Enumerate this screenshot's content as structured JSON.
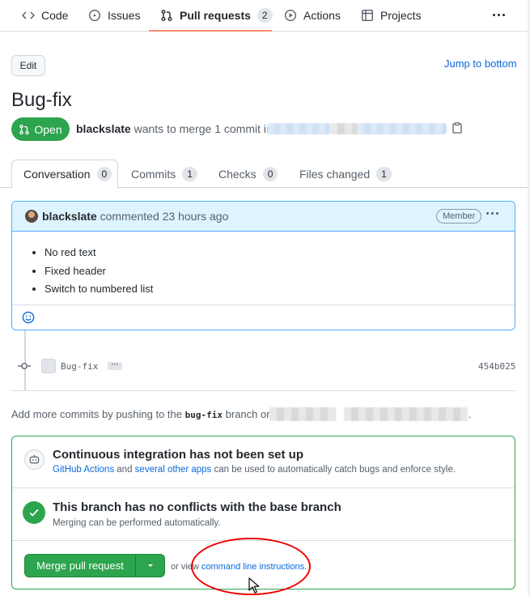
{
  "nav": {
    "items": [
      {
        "label": "Code",
        "icon": "code-icon"
      },
      {
        "label": "Issues",
        "icon": "issue-opened-icon"
      },
      {
        "label": "Pull requests",
        "icon": "git-pull-request-icon",
        "count": "2",
        "active": true
      },
      {
        "label": "Actions",
        "icon": "play-icon"
      },
      {
        "label": "Projects",
        "icon": "table-icon"
      }
    ]
  },
  "header": {
    "edit_label": "Edit",
    "jump_label": "Jump to bottom",
    "title": "Bug-fix",
    "state_label": "Open",
    "author": "blackslate",
    "merge_text": "wants to merge 1 commit into"
  },
  "tabs": [
    {
      "label": "Conversation",
      "count": "0"
    },
    {
      "label": "Commits",
      "count": "1"
    },
    {
      "label": "Checks",
      "count": "0"
    },
    {
      "label": "Files changed",
      "count": "1"
    }
  ],
  "comment": {
    "author": "blackslate",
    "action": "commented 23 hours ago",
    "badge": "Member",
    "items": [
      "No red text",
      "Fixed header",
      "Switch to numbered list"
    ]
  },
  "commit": {
    "message": "Bug-fix",
    "ellipsis": "···",
    "sha": "454b025"
  },
  "hint": {
    "before": "Add more commits by pushing to the",
    "branch": "bug-fix",
    "after": "branch on",
    "end": "."
  },
  "merge": {
    "ci_title": "Continuous integration has not been set up",
    "ci_link1": "GitHub Actions",
    "ci_and": "and",
    "ci_link2": "several other apps",
    "ci_rest": "can be used to automatically catch bugs and enforce style.",
    "conflict_title": "This branch has no conflicts with the base branch",
    "conflict_sub": "Merging can be performed automatically.",
    "merge_button": "Merge pull request",
    "or_view": "or view",
    "cli_link": "command line instructions."
  },
  "colors": {
    "accent": "#0969da",
    "success": "#2da44e",
    "annotation": "#ee0000"
  }
}
